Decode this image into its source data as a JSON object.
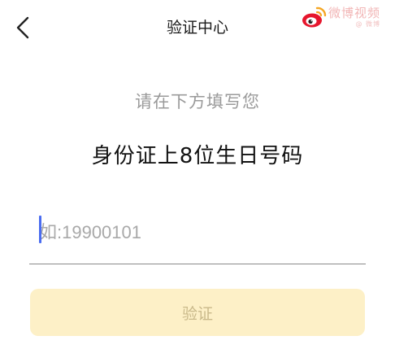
{
  "nav": {
    "title": "验证中心",
    "back_icon": "chevron-left-icon"
  },
  "watermark": {
    "logo_icon": "weibo-logo-icon",
    "main_text": "微博视频",
    "sub_text": "@ 微博"
  },
  "content": {
    "prompt": "请在下方填写您",
    "heading": "身份证上8位生日号码"
  },
  "form": {
    "birthday_value": "",
    "birthday_placeholder": "如:19900101",
    "cursor_color": "#4a6cf0",
    "verify_label": "验证",
    "verify_bg": "#fdf0c7",
    "verify_text_color": "#c9b98a"
  }
}
